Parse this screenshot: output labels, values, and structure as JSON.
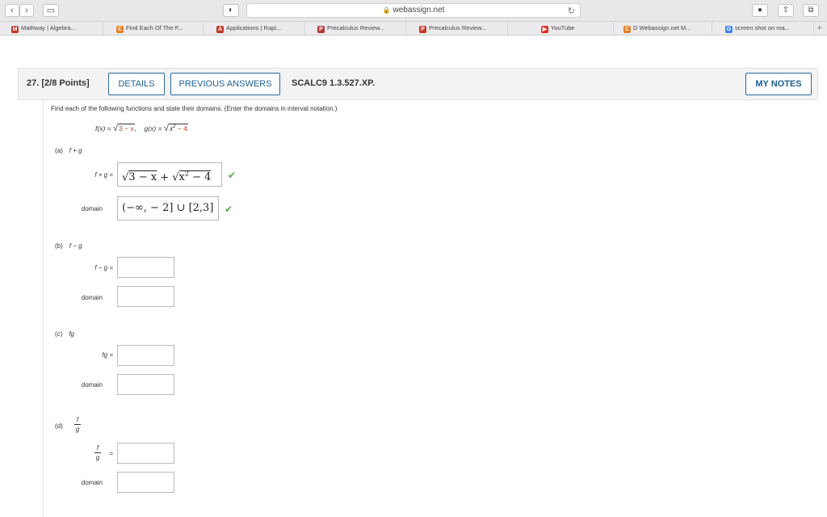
{
  "browser": {
    "url": "webassign.net",
    "bookmarks": [
      {
        "label": "Mathway | Algebra...",
        "icon": "M",
        "color": "#c0392b"
      },
      {
        "label": "Find Each Of The F...",
        "icon": "C",
        "color": "#e67e22"
      },
      {
        "label": "Applications | Rapi...",
        "icon": "A",
        "color": "#c0392b"
      },
      {
        "label": "Precalculus Review...",
        "icon": "P",
        "color": "#b23a3a"
      },
      {
        "label": "Precalculus Review...",
        "icon": "P",
        "color": "#c0392b"
      },
      {
        "label": "YouTube",
        "icon": "▶",
        "color": "#e52d27"
      },
      {
        "label": "D Webassign.net M...",
        "icon": "C",
        "color": "#e67e22"
      },
      {
        "label": "screen shot on ma...",
        "icon": "G",
        "color": "#4285f4"
      }
    ]
  },
  "question": {
    "number": "27.",
    "points": "[2/8 Points]",
    "details_label": "DETAILS",
    "previous_answers_label": "PREVIOUS ANSWERS",
    "code": "SCALC9 1.3.527.XP.",
    "my_notes_label": "MY NOTES",
    "instruction": "Find each of the following functions and state their domains. (Enter the domains in interval notation.)"
  },
  "formula": {
    "f_lhs": "f(x) = ",
    "f_rad": "3 − x",
    "sep": ",",
    "g_lhs": "g(x) = ",
    "g_rad_base": "x",
    "g_rad_exp": "2",
    "g_rad_tail": " − 4"
  },
  "parts": {
    "a": {
      "tag": "(a)",
      "expr": "f + g",
      "func_label": "f + g  =",
      "answer_prefix": "3 − x",
      "answer_plus": " + ",
      "answer_rad": "x",
      "answer_rad_exp": "2",
      "answer_rad_tail": " − 4",
      "domain_label": "domain",
      "domain_answer": "(−∞, − 2] ∪ [2,3]"
    },
    "b": {
      "tag": "(b)",
      "expr": "f − g",
      "func_label": "f − g  =",
      "domain_label": "domain"
    },
    "c": {
      "tag": "(c)",
      "expr": "fg",
      "func_label": "fg  =",
      "domain_label": "domain"
    },
    "d": {
      "tag": "(d)",
      "num": "f",
      "den": "g",
      "eq": "=",
      "domain_label": "domain"
    }
  }
}
